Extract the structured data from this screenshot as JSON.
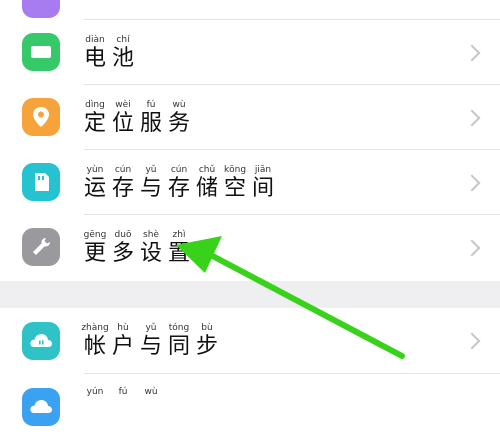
{
  "settings": {
    "items": [
      {
        "label": "电池",
        "pinyin": [
          "diàn",
          "chí"
        ],
        "icon": "battery-icon",
        "color": "#35c96a"
      },
      {
        "label": "定位服务",
        "pinyin": [
          "dìng",
          "wèi",
          "fú",
          "wù"
        ],
        "icon": "location-pin-icon",
        "color": "#f5a33a"
      },
      {
        "label": "运存与存储空间",
        "pinyin": [
          "yùn",
          "cún",
          "yǔ",
          "cún",
          "chǔ",
          "kōng",
          "jiān"
        ],
        "icon": "storage-card-icon",
        "color": "#25c2cf"
      },
      {
        "label": "更多设置",
        "pinyin": [
          "gēng",
          "duō",
          "shè",
          "zhì"
        ],
        "icon": "wrench-icon",
        "color": "#9a9a9e"
      },
      {
        "label": "帐户与同步",
        "pinyin": [
          "zhàng",
          "hù",
          "yǔ",
          "tóng",
          "bù"
        ],
        "icon": "cloud-sync-icon",
        "color": "#2fc3c8"
      },
      {
        "label": "",
        "pinyin": [
          "yún",
          "fú",
          "wù"
        ],
        "icon": "cloud-icon",
        "color": "#3aa2f0"
      }
    ]
  },
  "annotation": {
    "arrow_color": "#39d21a"
  }
}
